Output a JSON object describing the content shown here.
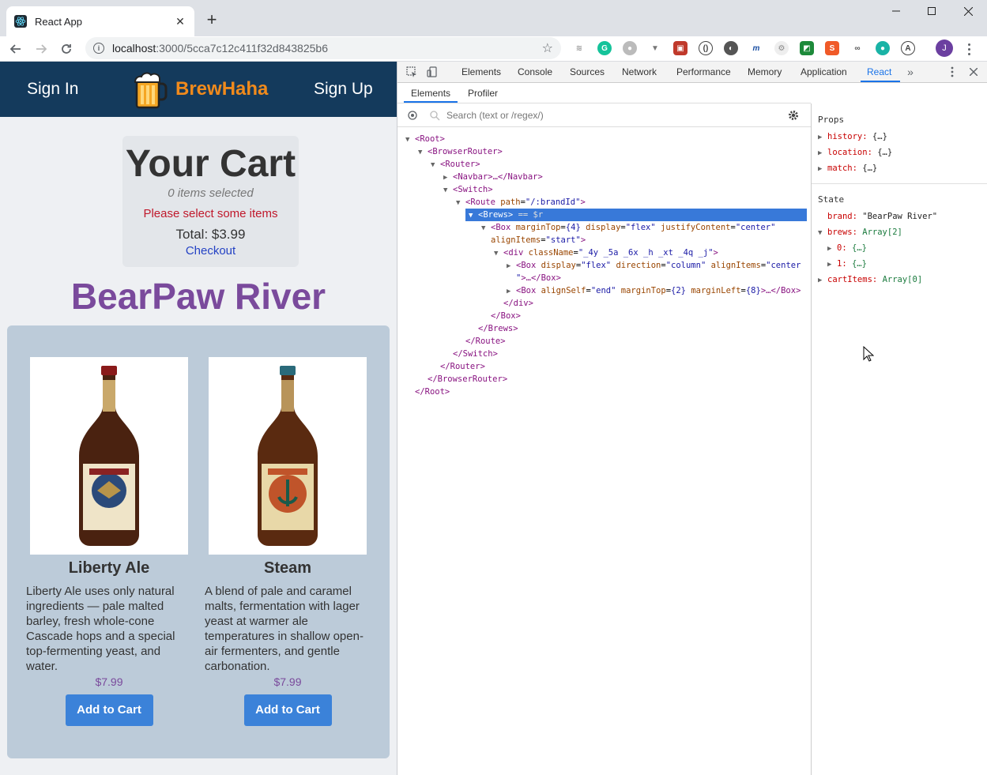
{
  "browser": {
    "tab_title": "React App",
    "url_host": "localhost",
    "url_path": ":3000/5cca7c12c411f32d843825b6"
  },
  "app": {
    "nav": {
      "sign_in": "Sign In",
      "brand": "BrewHaha",
      "sign_up": "Sign Up"
    },
    "cart": {
      "title": "Your Cart",
      "count": "0 items selected",
      "message": "Please select some items",
      "total": "Total: $3.99",
      "checkout": "Checkout"
    },
    "brand_heading": "BearPaw River",
    "brews": [
      {
        "name": "Liberty Ale",
        "description": "Liberty Ale uses only natural ingredients — pale malted barley, fresh whole-cone Cascade hops and a special top-fermenting yeast, and water.",
        "price": "$7.99",
        "button": "Add to Cart"
      },
      {
        "name": "Steam",
        "description": "A blend of pale and caramel malts, fermentation with lager yeast at warmer ale temperatures in shallow open-air fermenters, and gentle carbonation.",
        "price": "$7.99",
        "button": "Add to Cart"
      }
    ]
  },
  "devtools": {
    "tabs": [
      "Elements",
      "Console",
      "Sources",
      "Network",
      "Performance",
      "Memory",
      "Application",
      "React"
    ],
    "active_tab": "React",
    "subtabs": [
      "Elements",
      "Profiler"
    ],
    "search_placeholder": "Search (text or /regex/)",
    "props_heading": "Props",
    "props": [
      {
        "key": "history",
        "value": "{…}"
      },
      {
        "key": "location",
        "value": "{…}"
      },
      {
        "key": "match",
        "value": "{…}"
      }
    ],
    "state_heading": "State",
    "state": {
      "brand_key": "brand",
      "brand_value": "\"BearPaw River\"",
      "brews_key": "brews",
      "brews_value": "Array[2]",
      "brews_items": [
        {
          "key": "0",
          "value": "{…}"
        },
        {
          "key": "1",
          "value": "{…}"
        }
      ],
      "cart_key": "cartItems",
      "cart_value": "Array[0]"
    }
  }
}
